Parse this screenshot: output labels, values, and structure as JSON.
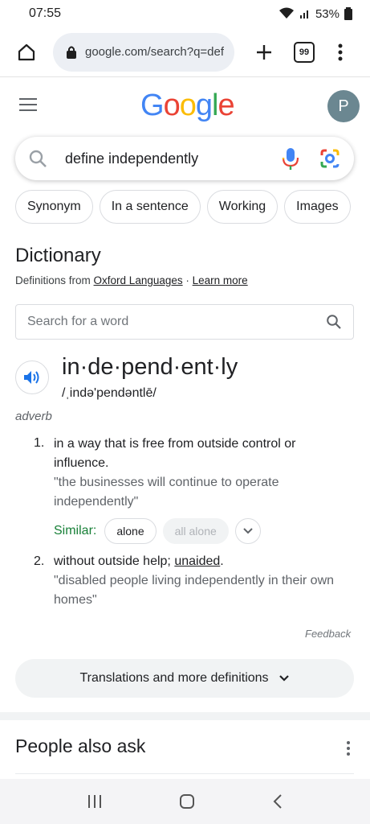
{
  "status_bar": {
    "time": "07:55",
    "battery": "53%"
  },
  "browser": {
    "url": "google.com/search?q=def",
    "tab_count": "99"
  },
  "google": {
    "logo_letters": [
      {
        "char": "G",
        "color": "#4285F4"
      },
      {
        "char": "o",
        "color": "#EA4335"
      },
      {
        "char": "o",
        "color": "#FBBC05"
      },
      {
        "char": "g",
        "color": "#4285F4"
      },
      {
        "char": "l",
        "color": "#34A853"
      },
      {
        "char": "e",
        "color": "#EA4335"
      }
    ],
    "avatar_letter": "P"
  },
  "search": {
    "query": "define independently"
  },
  "chips": [
    "Synonym",
    "In a sentence",
    "Working",
    "Images"
  ],
  "dictionary": {
    "title": "Dictionary",
    "source_prefix": "Definitions from ",
    "source_link": "Oxford Languages",
    "source_sep": " · ",
    "learn_more": "Learn more",
    "word_search_placeholder": "Search for a word",
    "headword": "in·de·pend·ent·ly",
    "phonetic": "/ˌində'pendəntlē/",
    "part_of_speech": "adverb",
    "definitions": [
      {
        "number": "1.",
        "text": "in a way that is free from outside control or influence.",
        "example": "\"the businesses will continue to operate independently\""
      },
      {
        "number": "2.",
        "text_before": "without outside help; ",
        "text_link": "unaided",
        "text_after": ".",
        "example": "\"disabled people living independently in their own homes\""
      }
    ],
    "similar_label": "Similar:",
    "similar_words": [
      "alone",
      "all alone"
    ],
    "feedback": "Feedback",
    "translations_button": "Translations and more definitions"
  },
  "people_also_ask": {
    "title": "People also ask"
  },
  "colors": {
    "accent_blue": "#1a73e8",
    "similar_green": "#188038"
  }
}
